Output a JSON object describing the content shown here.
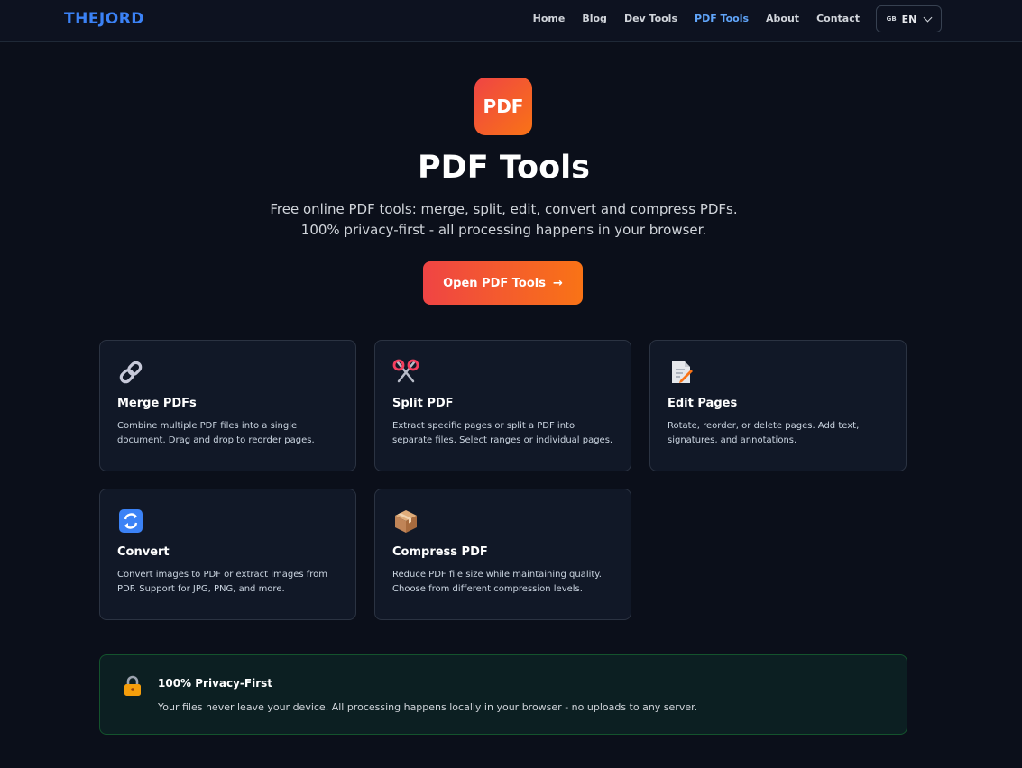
{
  "nav": {
    "logo": "THEJORD",
    "links": [
      "Home",
      "Blog",
      "Dev Tools",
      "PDF Tools",
      "About",
      "Contact"
    ],
    "active": "PDF Tools",
    "language": {
      "flag": "GB",
      "code": "EN"
    }
  },
  "hero": {
    "badge": "PDF",
    "title": "PDF Tools",
    "subtitle": "Free online PDF tools: merge, split, edit, convert and compress PDFs. 100% privacy-first - all processing happens in your browser.",
    "cta_label": "Open PDF Tools",
    "cta_arrow": "→"
  },
  "tools": [
    {
      "icon": "link-icon",
      "title": "Merge PDFs",
      "desc": "Combine multiple PDF files into a single document. Drag and drop to reorder pages."
    },
    {
      "icon": "scissors-icon",
      "title": "Split PDF",
      "desc": "Extract specific pages or split a PDF into separate files. Select ranges or individual pages."
    },
    {
      "icon": "memo-icon",
      "title": "Edit Pages",
      "desc": "Rotate, reorder, or delete pages. Add text, signatures, and annotations."
    },
    {
      "icon": "convert-icon",
      "title": "Convert",
      "desc": "Convert images to PDF or extract images from PDF. Support for JPG, PNG, and more."
    },
    {
      "icon": "package-icon",
      "title": "Compress PDF",
      "desc": "Reduce PDF file size while maintaining quality. Choose from different compression levels."
    }
  ],
  "privacy": {
    "icon": "lock-icon",
    "title": "100% Privacy-First",
    "desc": "Your files never leave your device. All processing happens locally in your browser - no uploads to any server."
  },
  "colors": {
    "accent_blue": "#3b82f6",
    "accent_orange": "#f97316",
    "accent_red": "#ef4444",
    "background": "#0b0f1a",
    "card": "#111827"
  }
}
